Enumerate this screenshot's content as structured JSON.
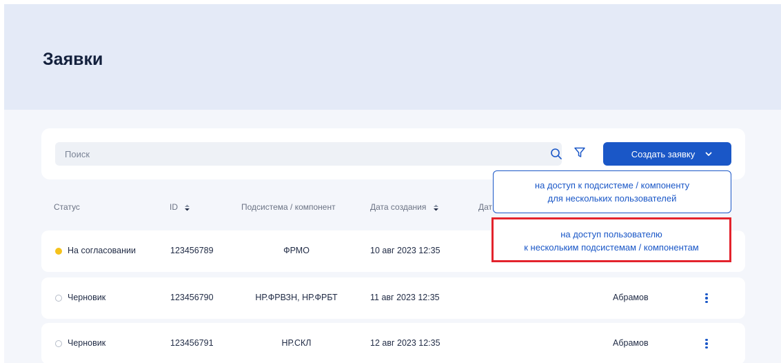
{
  "header": {
    "title": "Заявки"
  },
  "toolbar": {
    "search_placeholder": "Поиск",
    "create_label": "Создать заявку"
  },
  "dropdown": {
    "items": [
      {
        "line1": "на доступ к подсистеме / компоненту",
        "line2": "для нескольких пользователей"
      },
      {
        "line1": "на доступ пользователю",
        "line2": "к нескольким подсистемам / компонентам"
      }
    ]
  },
  "table": {
    "columns": [
      "Статус",
      "ID",
      "Подсистема / компонент",
      "Дата создания",
      "Дат"
    ],
    "rows": [
      {
        "status": "На согласовании",
        "status_color": "#f5c21b",
        "id": "123456789",
        "subsystem": "ФРМО",
        "created": "10 авг 2023  12:35",
        "author": ""
      },
      {
        "status": "Черновик",
        "status_color": "none",
        "id": "123456790",
        "subsystem": "НР.ФРВЗН, НР.ФРБТ",
        "created": "11 авг 2023  12:35",
        "author": "Абрамов"
      },
      {
        "status": "Черновик",
        "status_color": "none",
        "id": "123456791",
        "subsystem": "НР.СКЛ",
        "created": "12 авг 2023  12:35",
        "author": "Абрамов"
      }
    ]
  },
  "icons": {
    "search": "search-icon",
    "filter": "filter-icon",
    "chevron": "chevron-down-icon",
    "sort": "sort-icon",
    "more": "kebab-menu-icon"
  },
  "colors": {
    "accent": "#1a57c7",
    "header_bg": "#e4eaf7",
    "highlight": "#e3232c",
    "pending": "#f5c21b"
  }
}
